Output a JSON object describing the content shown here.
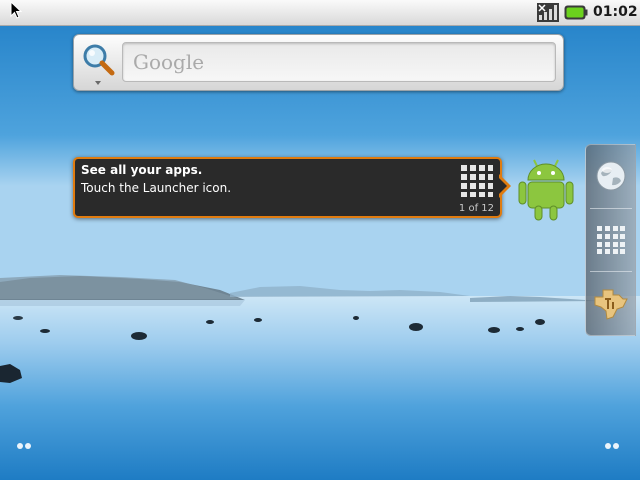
{
  "status_bar": {
    "clock": "01:02",
    "icons": [
      "cursor-icon",
      "signal-icon",
      "battery-icon"
    ],
    "battery_color": "#6bd21d"
  },
  "search_widget": {
    "placeholder": "Google",
    "icon": "search-icon"
  },
  "hint_bubble": {
    "title": "See all your apps.",
    "body": "Touch the Launcher icon.",
    "counter": "1 of 12",
    "border_color": "#e07c10",
    "icon": "launcher-grid-icon"
  },
  "mascot": {
    "icon": "android-icon",
    "color": "#8cc63f"
  },
  "dock": {
    "items": [
      {
        "icon": "browser-globe-icon"
      },
      {
        "icon": "launcher-grid-icon"
      },
      {
        "icon": "ti-logo-icon"
      }
    ]
  },
  "page_indicators": {
    "left": "page-indicator-left",
    "right": "page-indicator-right"
  }
}
